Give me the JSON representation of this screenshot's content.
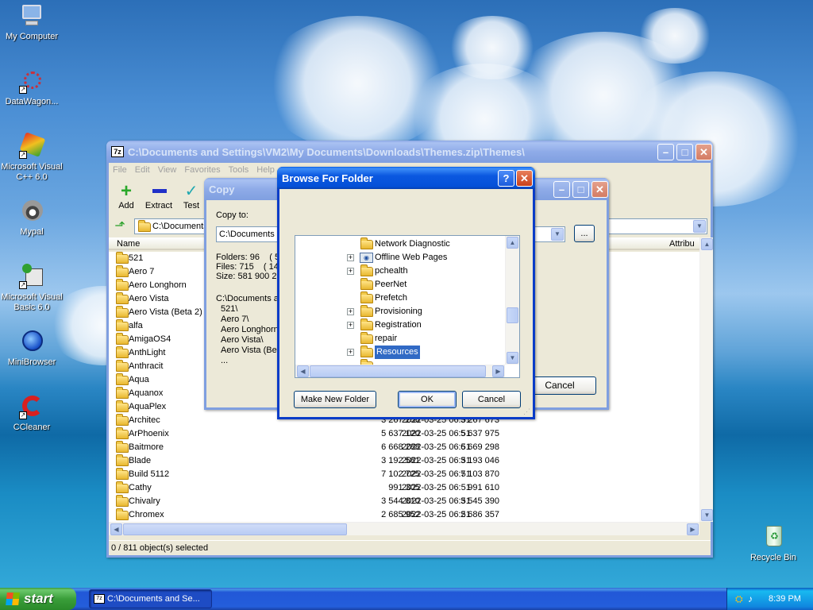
{
  "desktop": {
    "icons": [
      {
        "label": "My Computer",
        "icon": "my-computer-icon"
      },
      {
        "label": "DataWagon...",
        "icon": "datawagon-icon"
      },
      {
        "label": "Microsoft Visual C++ 6.0",
        "icon": "visual-cpp-icon"
      },
      {
        "label": "Mypal",
        "icon": "mypal-icon"
      },
      {
        "label": "Microsoft Visual Basic 6.0",
        "icon": "visual-basic-icon"
      },
      {
        "label": "MiniBrowser",
        "icon": "minibrowser-icon"
      },
      {
        "label": "CCleaner",
        "icon": "ccleaner-icon"
      },
      {
        "label": "Recycle Bin",
        "icon": "recycle-bin-icon"
      }
    ]
  },
  "main_window": {
    "title": "C:\\Documents and Settings\\VM2\\My Documents\\Downloads\\Themes.zip\\Themes\\",
    "app_icon": "7z",
    "menu": [
      "File",
      "Edit",
      "View",
      "Favorites",
      "Tools",
      "Help"
    ],
    "toolbar": {
      "add": "Add",
      "extract": "Extract",
      "test": "Test"
    },
    "path": "C:\\Documents",
    "columns": {
      "name": "Name",
      "attrib": "Attribu"
    },
    "files": [
      {
        "name": "521"
      },
      {
        "name": "Aero 7"
      },
      {
        "name": "Aero Longhorn"
      },
      {
        "name": "Aero Vista"
      },
      {
        "name": "Aero Vista (Beta 2)"
      },
      {
        "name": "alfa"
      },
      {
        "name": "AmigaOS4"
      },
      {
        "name": "AnthLight"
      },
      {
        "name": "Anthracit"
      },
      {
        "name": "Aqua"
      },
      {
        "name": "Aquanox"
      },
      {
        "name": "AquaPlex"
      },
      {
        "name": "Architec",
        "size": "3 267 256",
        "packed": "3 267 673",
        "modified": "2022-03-25 06:51"
      },
      {
        "name": "ArPhoenix",
        "size": "5 637 120",
        "packed": "5 637 975",
        "modified": "2022-03-25 06:51"
      },
      {
        "name": "Baitmore",
        "size": "6 668 288",
        "packed": "6 669 298",
        "modified": "2022-03-25 06:51"
      },
      {
        "name": "Blade",
        "size": "3 192 581",
        "packed": "3 193 046",
        "modified": "2022-03-25 06:51"
      },
      {
        "name": "Build 5112",
        "size": "7 102 725",
        "packed": "7 103 870",
        "modified": "2022-03-25 06:51"
      },
      {
        "name": "Cathy",
        "size": "991 305",
        "packed": "991 610",
        "modified": "2022-03-25 06:51"
      },
      {
        "name": "Chivalry",
        "size": "3 544 810",
        "packed": "3 545 390",
        "modified": "2022-03-25 06:51"
      },
      {
        "name": "Chromex",
        "size": "2 685 952",
        "packed": "2 686 357",
        "modified": "2022-03-25 06:51"
      }
    ],
    "status": "0 / 811 object(s) selected"
  },
  "copy_dialog": {
    "title": "Copy",
    "copy_to_label": "Copy to:",
    "copy_to_value": "C:\\Documents a",
    "browse": "...",
    "info": [
      "Folders: 96    ( 5",
      "Files: 715    ( 14",
      "Size: 581 900 21"
    ],
    "list": [
      "C:\\Documents a",
      "521\\",
      "Aero 7\\",
      "Aero Longhorn",
      "Aero Vista\\",
      "Aero Vista (Bet",
      "..."
    ],
    "cancel": "Cancel"
  },
  "browse_dialog": {
    "title": "Browse For Folder",
    "tree": [
      {
        "label": "Network Diagnostic",
        "expand": false,
        "icon": "folder-icon"
      },
      {
        "label": "Offline Web Pages",
        "expand": true,
        "icon": "offline-web-pages-icon"
      },
      {
        "label": "pchealth",
        "expand": true,
        "icon": "folder-icon"
      },
      {
        "label": "PeerNet",
        "expand": false,
        "icon": "folder-icon"
      },
      {
        "label": "Prefetch",
        "expand": false,
        "icon": "folder-icon"
      },
      {
        "label": "Provisioning",
        "expand": true,
        "icon": "folder-icon"
      },
      {
        "label": "Registration",
        "expand": true,
        "icon": "folder-icon"
      },
      {
        "label": "repair",
        "expand": false,
        "icon": "folder-icon"
      },
      {
        "label": "Resources",
        "expand": true,
        "icon": "folder-icon",
        "selected": true
      }
    ],
    "make_new_folder": "Make New Folder",
    "ok": "OK",
    "cancel": "Cancel"
  },
  "taskbar": {
    "start": "start",
    "task": "C:\\Documents and Se...",
    "time": "8:39 PM"
  }
}
